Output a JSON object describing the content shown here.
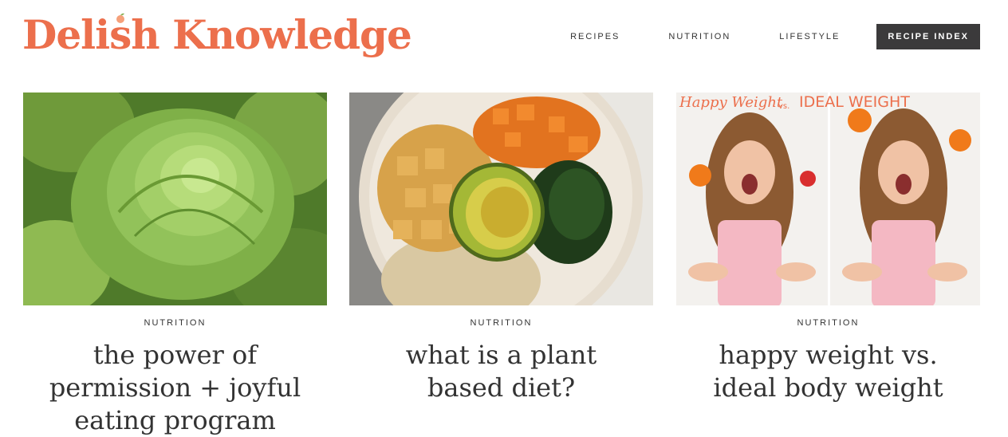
{
  "site": {
    "logo_text": "Delish Knowledge"
  },
  "nav": {
    "items": [
      {
        "label": "RECIPES"
      },
      {
        "label": "NUTRITION"
      },
      {
        "label": "LIFESTYLE"
      }
    ],
    "cta_label": "RECIPE INDEX"
  },
  "cards": [
    {
      "category": "NUTRITION",
      "title": "the power of permission + joyful eating program",
      "image": "lettuce-photo"
    },
    {
      "category": "NUTRITION",
      "title": "what is a plant based diet?",
      "image": "grain-bowl-photo"
    },
    {
      "category": "NUTRITION",
      "title": "happy weight vs. ideal body weight",
      "image": "happy-weight-photo",
      "image_text_left": "Happy Weight",
      "image_text_vs": "vs.",
      "image_text_right": "IDEAL WEIGHT"
    }
  ],
  "colors": {
    "brand": "#ec6f4c",
    "cta_bg": "#3b3a3b",
    "text": "#333333"
  }
}
